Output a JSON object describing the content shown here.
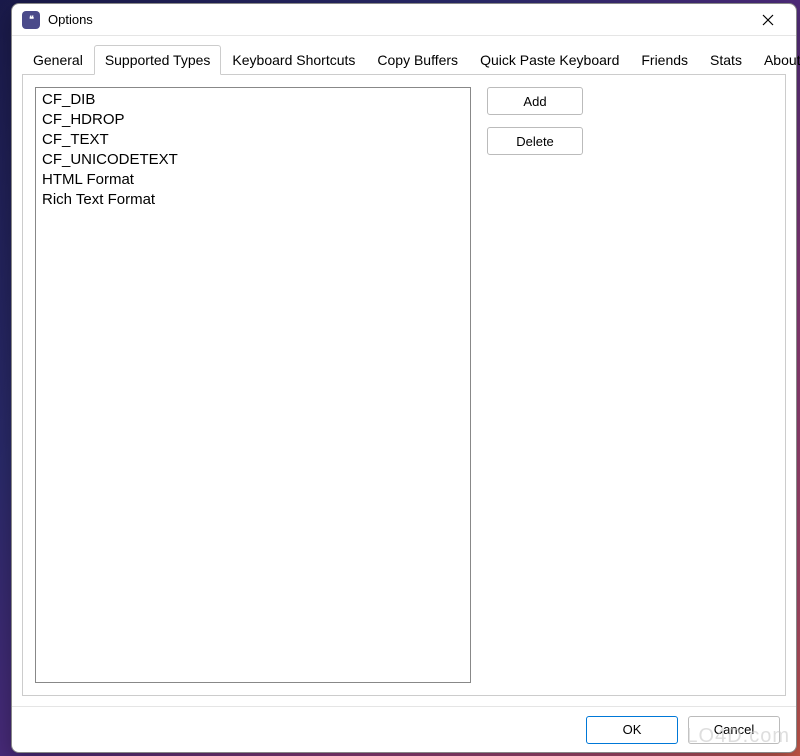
{
  "window": {
    "title": "Options"
  },
  "tabs": [
    {
      "label": "General"
    },
    {
      "label": "Supported Types"
    },
    {
      "label": "Keyboard Shortcuts"
    },
    {
      "label": "Copy Buffers"
    },
    {
      "label": "Quick Paste Keyboard"
    },
    {
      "label": "Friends"
    },
    {
      "label": "Stats"
    },
    {
      "label": "About"
    }
  ],
  "active_tab_index": 1,
  "supported_types": {
    "items": [
      "CF_DIB",
      "CF_HDROP",
      "CF_TEXT",
      "CF_UNICODETEXT",
      "HTML Format",
      "Rich Text Format"
    ],
    "buttons": {
      "add": "Add",
      "delete": "Delete"
    }
  },
  "footer": {
    "ok": "OK",
    "cancel": "Cancel"
  },
  "watermark": "LO4D.com"
}
